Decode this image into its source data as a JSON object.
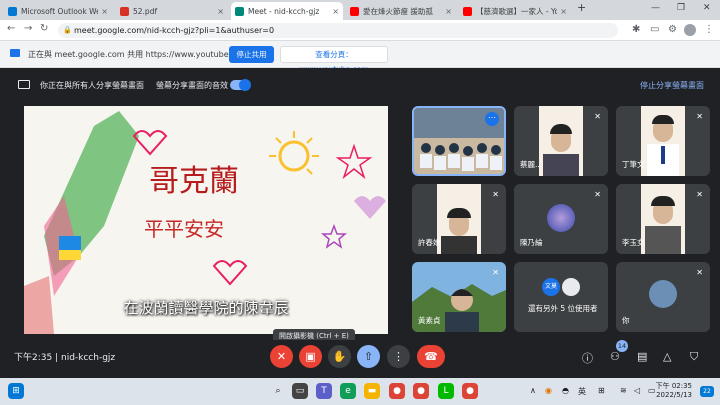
{
  "browser": {
    "tabs": [
      {
        "title": "Microsoft Outlook Web",
        "color": "#0078d4"
      },
      {
        "title": "52.pdf",
        "color": "#d93025"
      },
      {
        "title": "Meet - nid-kcch-gjz",
        "color": "#00897b"
      },
      {
        "title": "愛在烽火節瘦 援助孤",
        "color": "#ff0000"
      },
      {
        "title": "【慈濟歌選】一家人 - Yo",
        "color": "#ff0000"
      }
    ],
    "new_tab": "+",
    "url": "meet.google.com/nid-kcch-gjz?pli=1&authuser=0"
  },
  "sharebar": {
    "message": "正在與 meet.google.com 共用 https://www.youtube.com",
    "stop_label": "停止共用",
    "view_label": "查看分頁：www.youtube.com"
  },
  "meet": {
    "presenting_text": "你正在與所有人分享螢幕畫面",
    "sound_text": "螢幕分享畫面的音效",
    "stop_sharing": "停止分享螢幕畫面",
    "subtitle": "在波蘭讀醫學院的陳韋辰",
    "participants": [
      {
        "name": ""
      },
      {
        "name": "蔡麗..."
      },
      {
        "name": "丁筆文"
      },
      {
        "name": "許春嬌"
      },
      {
        "name": "陳乃綸"
      },
      {
        "name": "李玉女"
      },
      {
        "name": "黃素貞"
      },
      {
        "name": "還有另外 5 位使用者",
        "avatar": "文莫"
      },
      {
        "name": "你"
      }
    ],
    "tooltip": "開啟攝影機 (Ctrl + E)",
    "time": "下午2:35",
    "meeting_code": "nid-kcch-gjz",
    "participant_count": "14"
  },
  "taskbar": {
    "lang": "英",
    "time": "下午 02:35",
    "date": "2022/5/13",
    "notif": "22"
  }
}
